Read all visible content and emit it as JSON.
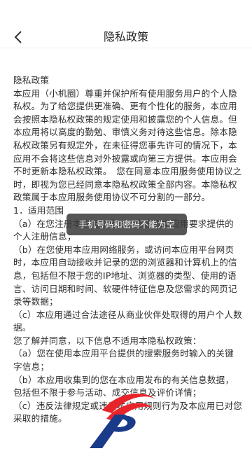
{
  "header": {
    "title": "隐私政策"
  },
  "content": {
    "paragraphs": [
      "隐私政策",
      "本应用（小机圈）尊重并保护所有使用服务用户的个人隐私权。为了给您提供更准确、更有个性化的服务，本应用会按照本隐私权政策的规定使用和披露您的个人信息。但本应用将以高度的勤勉、审慎义务对待这些信息。除本隐私权政策另有规定外，在未征得您事先许可的情况下，本应用不会将这些信息对外披露或向第三方提供。本应用会不时更新本隐私权政策。　您在同意本应用服务使用协议之时，即视为您已经同意本隐私权政策全部内容。本隐私权政策属于本应用服务使用协议不可分割的一部分。",
      "1．适用范围",
      "（a）在您注册本应用帐号时，您根据本应用要求提供的个人注册信息；",
      "（b）在您使用本应用网络服务，或访问本应用平台网页时，本应用自动接收并记录的您的浏览器和计算机上的信息，包括但不限于您的IP地址、浏览器的类型、使用的语言、访问日期和时间、软硬件特征信息及您需求的网页记录等数据；",
      "（c）本应用通过合法途径从商业伙伴处取得的用户个人数据。",
      "您了解并同意，以下信息不适用本隐私权政策：",
      "（a）您在使用本应用平台提供的搜索服务时输入的关键字信息；",
      "（b）本应用收集到的您在本应用发布的有关信息数据，包括但不限于参与活动、成交信息及评价详情；",
      "（c）违反法律规定或违反本应用规则行为及本应用已对您采取的措施。"
    ]
  },
  "toast": {
    "message": "手机号码和密码不能为空"
  },
  "colors": {
    "toast_bg": "#3a3a3a",
    "logo_red": "#e8242b",
    "logo_blue": "#1a3a8a"
  }
}
